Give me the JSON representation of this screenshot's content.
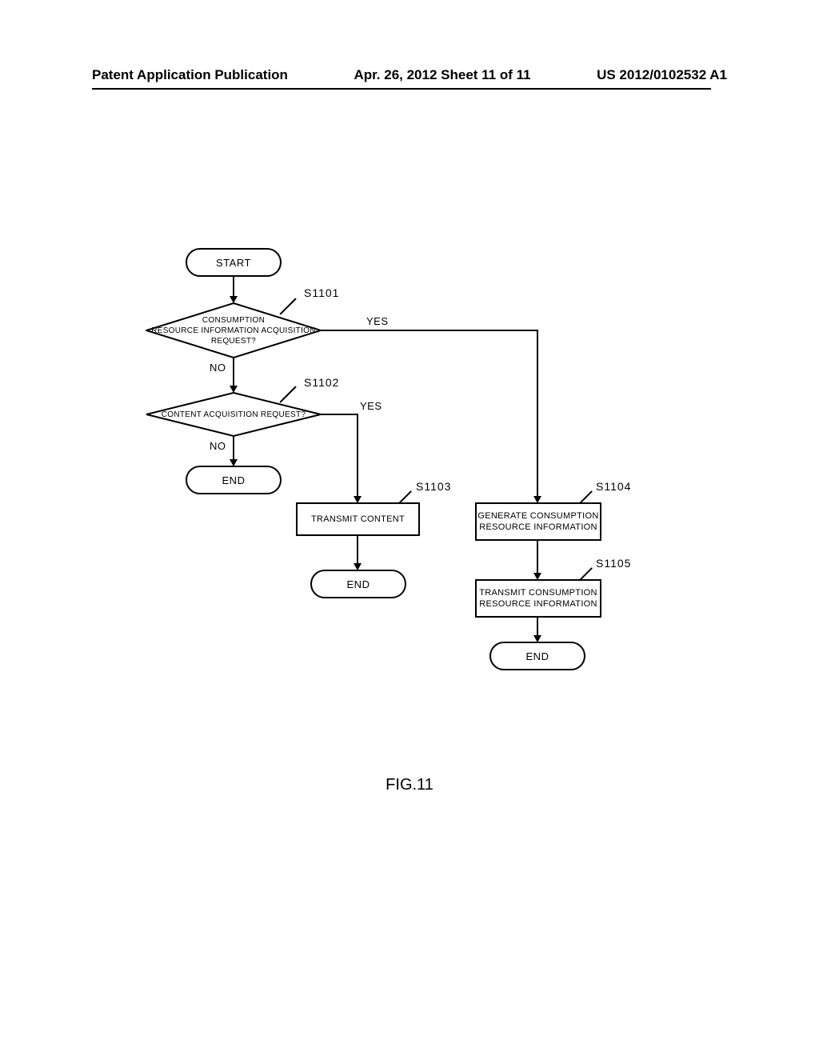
{
  "header": {
    "left": "Patent Application Publication",
    "center": "Apr. 26, 2012  Sheet 11 of 11",
    "right": "US 2012/0102532 A1"
  },
  "flowchart": {
    "start": "START",
    "d1": {
      "line1": "CONSUMPTION",
      "line2": "RESOURCE INFORMATION ACQUISITION",
      "line3": "REQUEST?",
      "step": "S1101",
      "yes": "YES",
      "no": "NO"
    },
    "d2": {
      "text": "CONTENT ACQUISITION REQUEST?",
      "step": "S1102",
      "yes": "YES",
      "no": "NO"
    },
    "p1": {
      "text": "TRANSMIT CONTENT",
      "step": "S1103"
    },
    "p2": {
      "line1": "GENERATE CONSUMPTION",
      "line2": "RESOURCE INFORMATION",
      "step": "S1104"
    },
    "p3": {
      "line1": "TRANSMIT CONSUMPTION",
      "line2": "RESOURCE INFORMATION",
      "step": "S1105"
    },
    "end1": "END",
    "end2": "END",
    "end3": "END"
  },
  "figure": "FIG.11",
  "chart_data": {
    "type": "flowchart",
    "title": "FIG.11",
    "nodes": [
      {
        "id": "start",
        "type": "terminal",
        "text": "START"
      },
      {
        "id": "S1101",
        "type": "decision",
        "text": "CONSUMPTION RESOURCE INFORMATION ACQUISITION REQUEST?"
      },
      {
        "id": "S1102",
        "type": "decision",
        "text": "CONTENT ACQUISITION REQUEST?"
      },
      {
        "id": "S1103",
        "type": "process",
        "text": "TRANSMIT CONTENT"
      },
      {
        "id": "S1104",
        "type": "process",
        "text": "GENERATE CONSUMPTION RESOURCE INFORMATION"
      },
      {
        "id": "S1105",
        "type": "process",
        "text": "TRANSMIT CONSUMPTION RESOURCE INFORMATION"
      },
      {
        "id": "end1",
        "type": "terminal",
        "text": "END"
      },
      {
        "id": "end2",
        "type": "terminal",
        "text": "END"
      },
      {
        "id": "end3",
        "type": "terminal",
        "text": "END"
      }
    ],
    "edges": [
      {
        "from": "start",
        "to": "S1101"
      },
      {
        "from": "S1101",
        "to": "S1104",
        "label": "YES"
      },
      {
        "from": "S1101",
        "to": "S1102",
        "label": "NO"
      },
      {
        "from": "S1102",
        "to": "S1103",
        "label": "YES"
      },
      {
        "from": "S1102",
        "to": "end1",
        "label": "NO"
      },
      {
        "from": "S1103",
        "to": "end2"
      },
      {
        "from": "S1104",
        "to": "S1105"
      },
      {
        "from": "S1105",
        "to": "end3"
      }
    ]
  }
}
